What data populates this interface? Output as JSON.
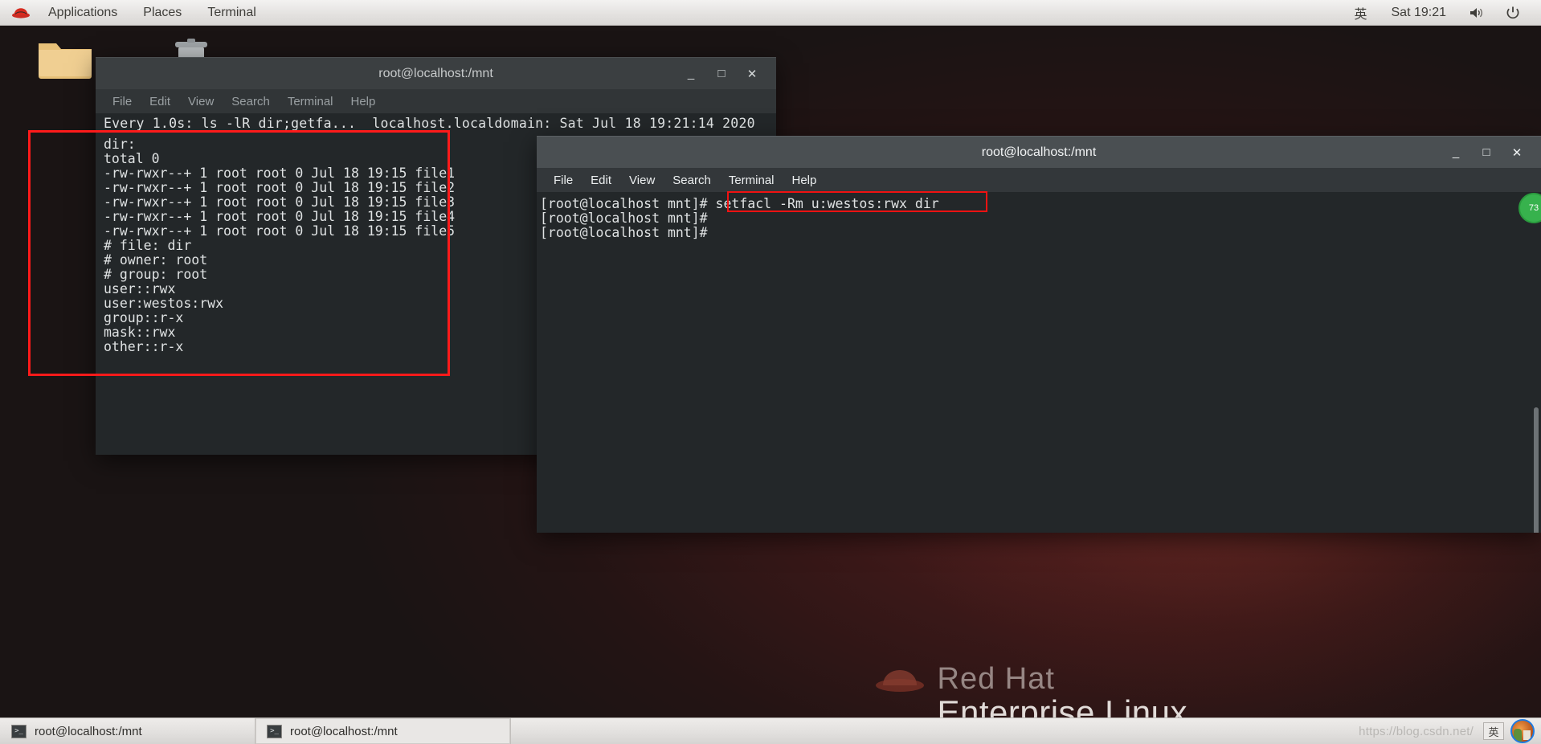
{
  "topbar": {
    "logo_icon": "redhat-logo-icon",
    "menus": [
      "Applications",
      "Places",
      "Terminal"
    ],
    "ime": "英",
    "clock": "Sat 19:21",
    "volume_icon": "speaker-icon",
    "power_icon": "power-icon"
  },
  "desktop": {
    "brand_line1": "Red Hat",
    "brand_line2": "Enterprise Linux",
    "icons": [
      {
        "name": "folder-icon",
        "label": ""
      },
      {
        "name": "trash-icon",
        "label": ""
      }
    ]
  },
  "window1": {
    "title": "root@localhost:/mnt",
    "menu": [
      "File",
      "Edit",
      "View",
      "Search",
      "Terminal",
      "Help"
    ],
    "buttons": {
      "minimize": "_",
      "maximize": "□",
      "close": "✕"
    },
    "watch_header": "Every 1.0s: ls -lR dir;getfa...  localhost.localdomain: Sat Jul 18 19:21:14 2020",
    "lines": [
      "dir:",
      "total 0",
      "-rw-rwxr--+ 1 root root 0 Jul 18 19:15 file1",
      "-rw-rwxr--+ 1 root root 0 Jul 18 19:15 file2",
      "-rw-rwxr--+ 1 root root 0 Jul 18 19:15 file3",
      "-rw-rwxr--+ 1 root root 0 Jul 18 19:15 file4",
      "-rw-rwxr--+ 1 root root 0 Jul 18 19:15 file5",
      "# file: dir",
      "# owner: root",
      "# group: root",
      "user::rwx",
      "user:westos:rwx",
      "group::r-x",
      "mask::rwx",
      "other::r-x"
    ],
    "highlight_color": "#ff1a1a"
  },
  "window2": {
    "title": "root@localhost:/mnt",
    "menu": [
      "File",
      "Edit",
      "View",
      "Search",
      "Terminal",
      "Help"
    ],
    "buttons": {
      "minimize": "_",
      "maximize": "□",
      "close": "✕"
    },
    "lines": [
      "[root@localhost mnt]# setfacl -Rm u:westos:rwx dir",
      "[root@localhost mnt]#",
      "[root@localhost mnt]#"
    ],
    "highlighted_command": "setfacl -Rm u:westos:rwx dir",
    "highlight_color": "#f01212"
  },
  "side_badge": {
    "label": "73"
  },
  "taskbar": {
    "items": [
      {
        "label": "root@localhost:/mnt",
        "icon": "terminal-icon",
        "selected": false
      },
      {
        "label": "root@localhost:/mnt",
        "icon": "terminal-icon",
        "selected": true
      }
    ],
    "watermark": "https://blog.csdn.net/",
    "tray_box": "英",
    "avatar": "user-avatar"
  }
}
